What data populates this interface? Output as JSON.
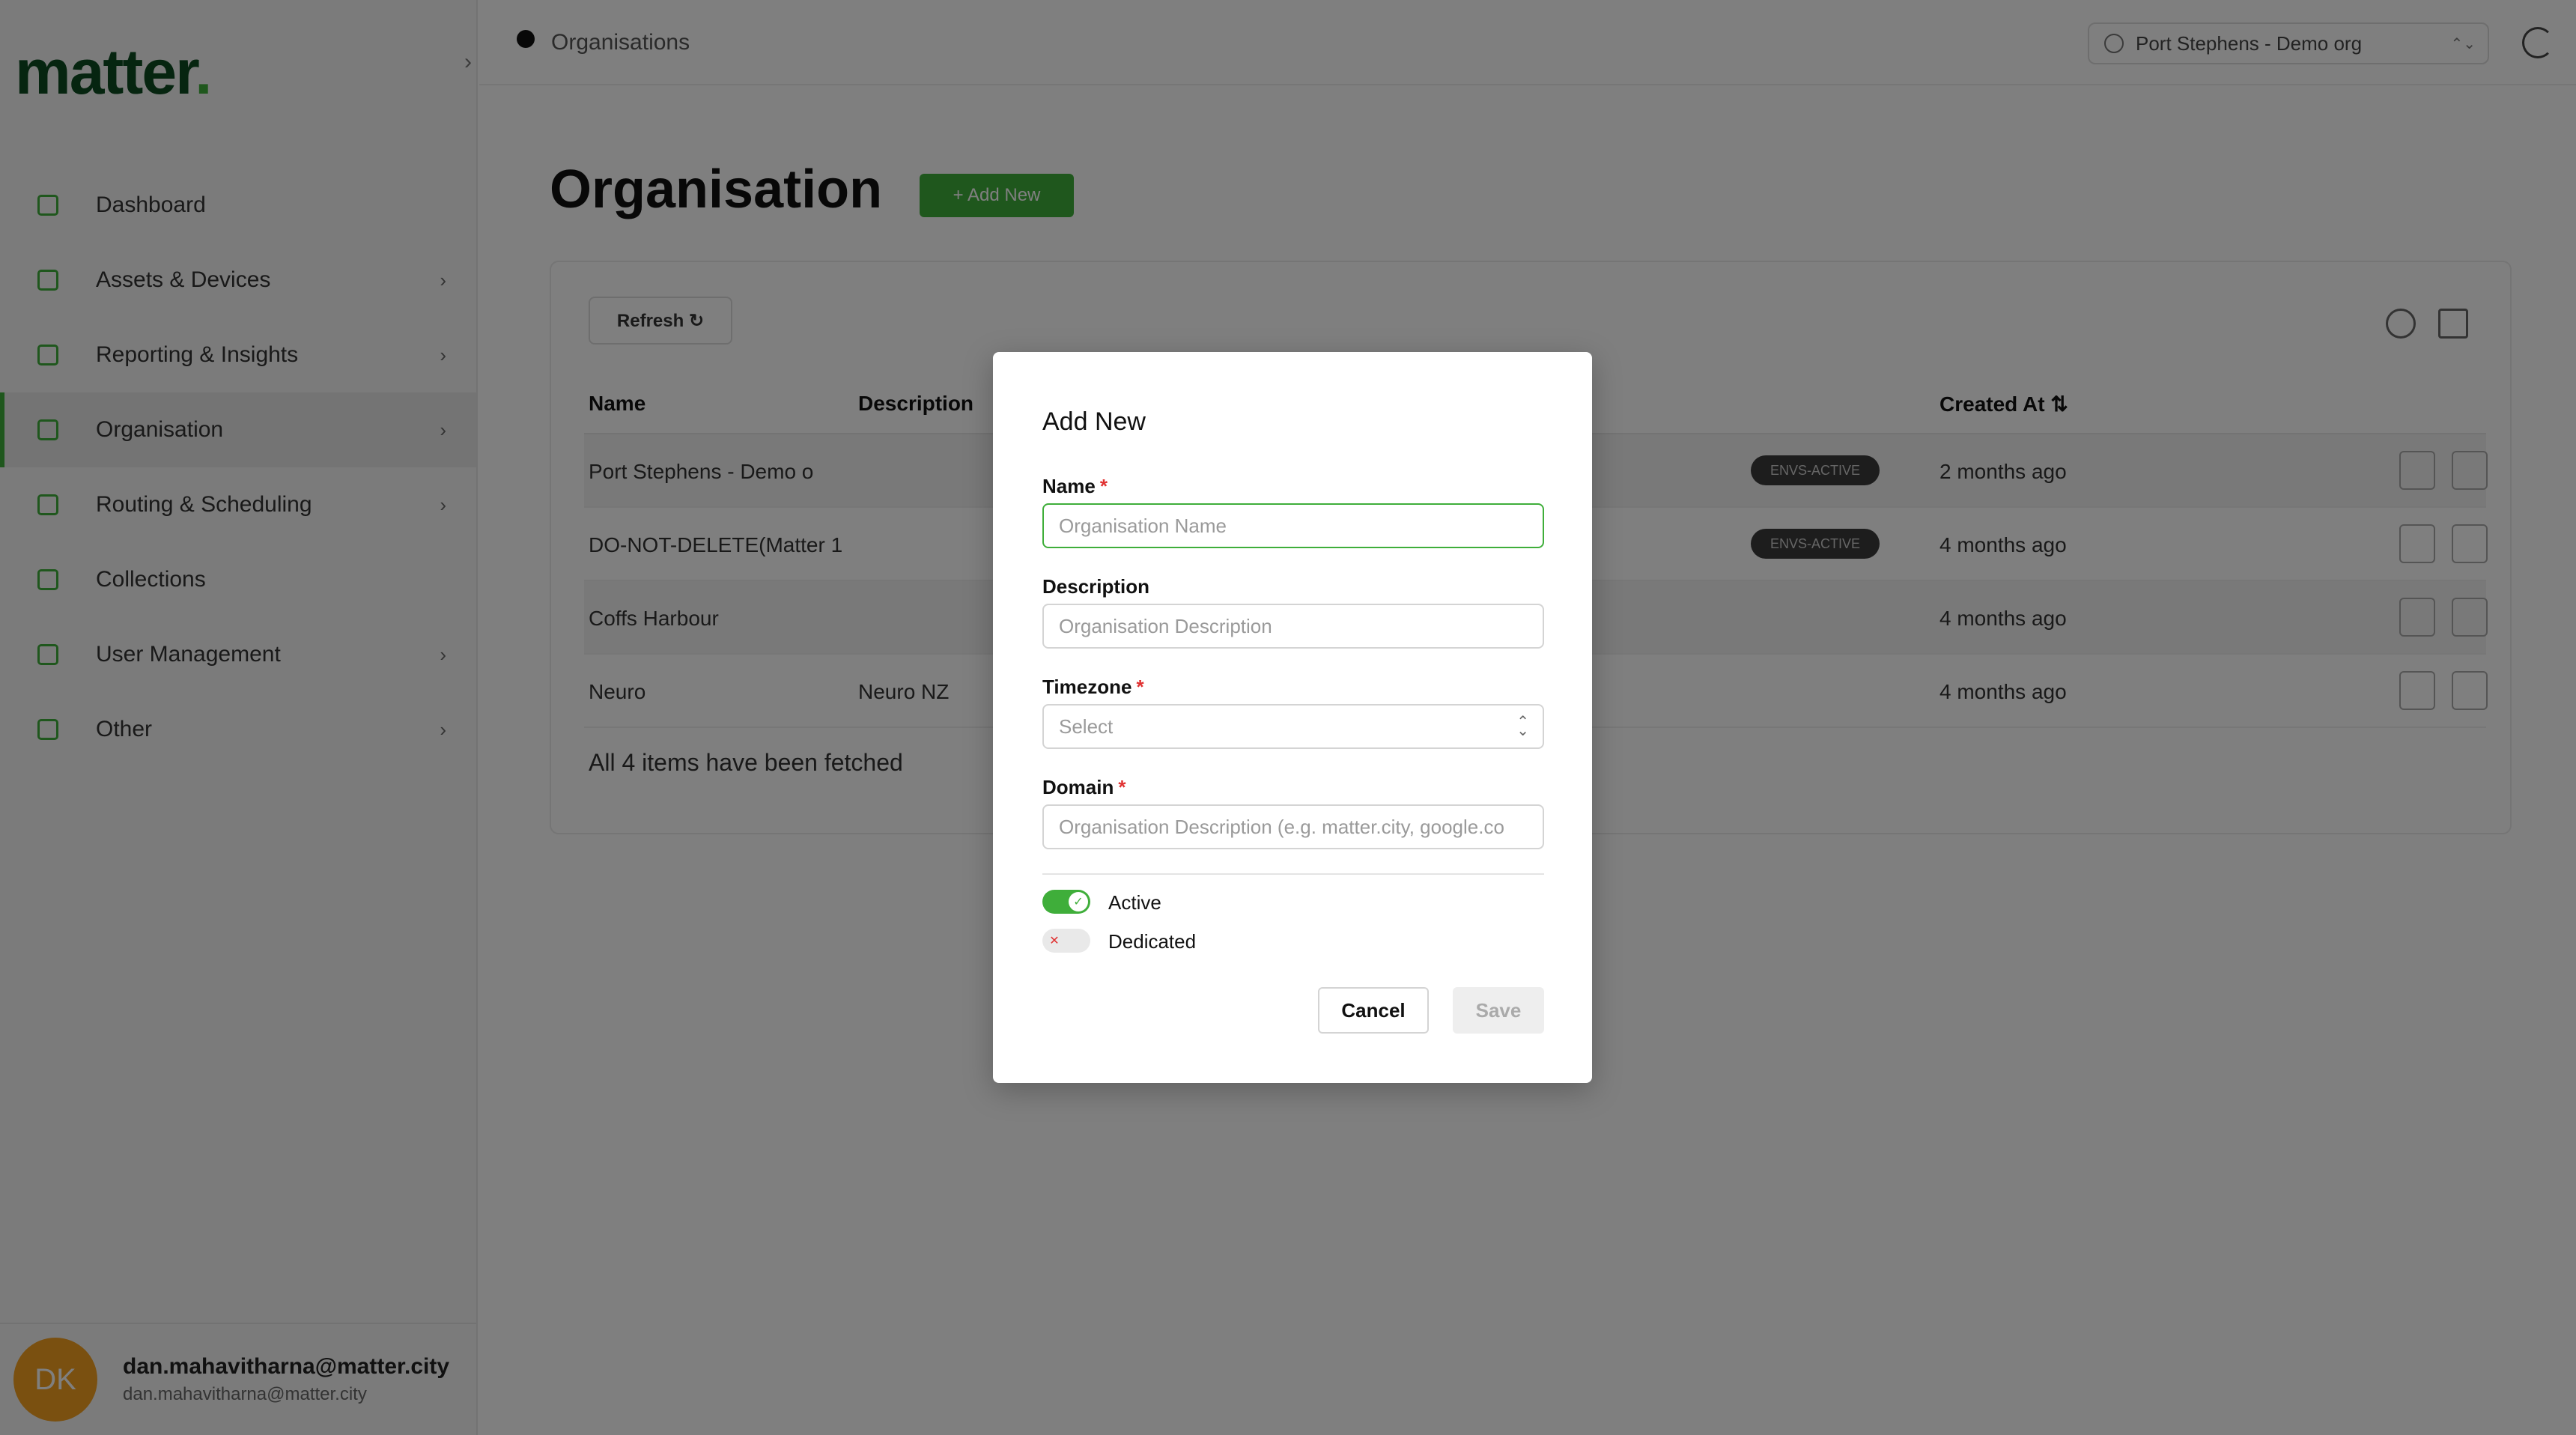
{
  "sidebar": {
    "logo": "matter",
    "logo_dot": ".",
    "collapse_icon": "›",
    "items": [
      {
        "label": "Dashboard",
        "chevron": ""
      },
      {
        "label": "Assets & Devices",
        "chevron": "›"
      },
      {
        "label": "Reporting & Insights",
        "chevron": "›"
      },
      {
        "label": "Organisation",
        "chevron": "›"
      },
      {
        "label": "Routing & Scheduling",
        "chevron": "›"
      },
      {
        "label": "Collections",
        "chevron": ""
      },
      {
        "label": "User Management",
        "chevron": "›"
      },
      {
        "label": "Other",
        "chevron": "›"
      }
    ],
    "user": {
      "initials": "DK",
      "name": "dan.mahavitharna@matter.city",
      "email": "dan.mahavitharna@matter.city"
    }
  },
  "header": {
    "breadcrumb": "Organisations",
    "org_selector": "Port Stephens - Demo org",
    "org_selector_arrow": "⌃⌄"
  },
  "page": {
    "title": "Organisation",
    "add_new_label": "+  Add New"
  },
  "table": {
    "refresh_label": "Refresh  ↻",
    "columns": [
      "Name",
      "Description",
      "Created At ⇅"
    ],
    "rows": [
      {
        "name": "Port Stephens - Demo o",
        "description": "",
        "badge": "ENVS-ACTIVE",
        "created": "2 months ago"
      },
      {
        "name": "DO-NOT-DELETE(Matter 1",
        "description": "",
        "badge": "ENVS-ACTIVE",
        "created": "4 months ago"
      },
      {
        "name": "Coffs Harbour",
        "description": "",
        "badge": "",
        "created": "4 months ago"
      },
      {
        "name": "Neuro",
        "description": "Neuro NZ",
        "badge": "",
        "created": "4 months ago"
      }
    ],
    "footer": "All 4 items have been fetched"
  },
  "modal": {
    "title": "Add New",
    "name_label": "Name",
    "name_placeholder": "Organisation Name",
    "description_label": "Description",
    "description_placeholder": "Organisation Description",
    "timezone_label": "Timezone",
    "timezone_value": "Select",
    "domain_label": "Domain",
    "domain_placeholder": "Organisation Description (e.g. matter.city, google.co",
    "required_mark": "*",
    "active_label": "Active",
    "active_on": true,
    "active_knob": "✓",
    "dedicated_label": "Dedicated",
    "dedicated_on": false,
    "dedicated_knob": "✕",
    "cancel_label": "Cancel",
    "save_label": "Save"
  },
  "colors": {
    "brand_green": "#3fae3a",
    "logo_dark": "#0c4a20",
    "required_red": "#e03131"
  }
}
